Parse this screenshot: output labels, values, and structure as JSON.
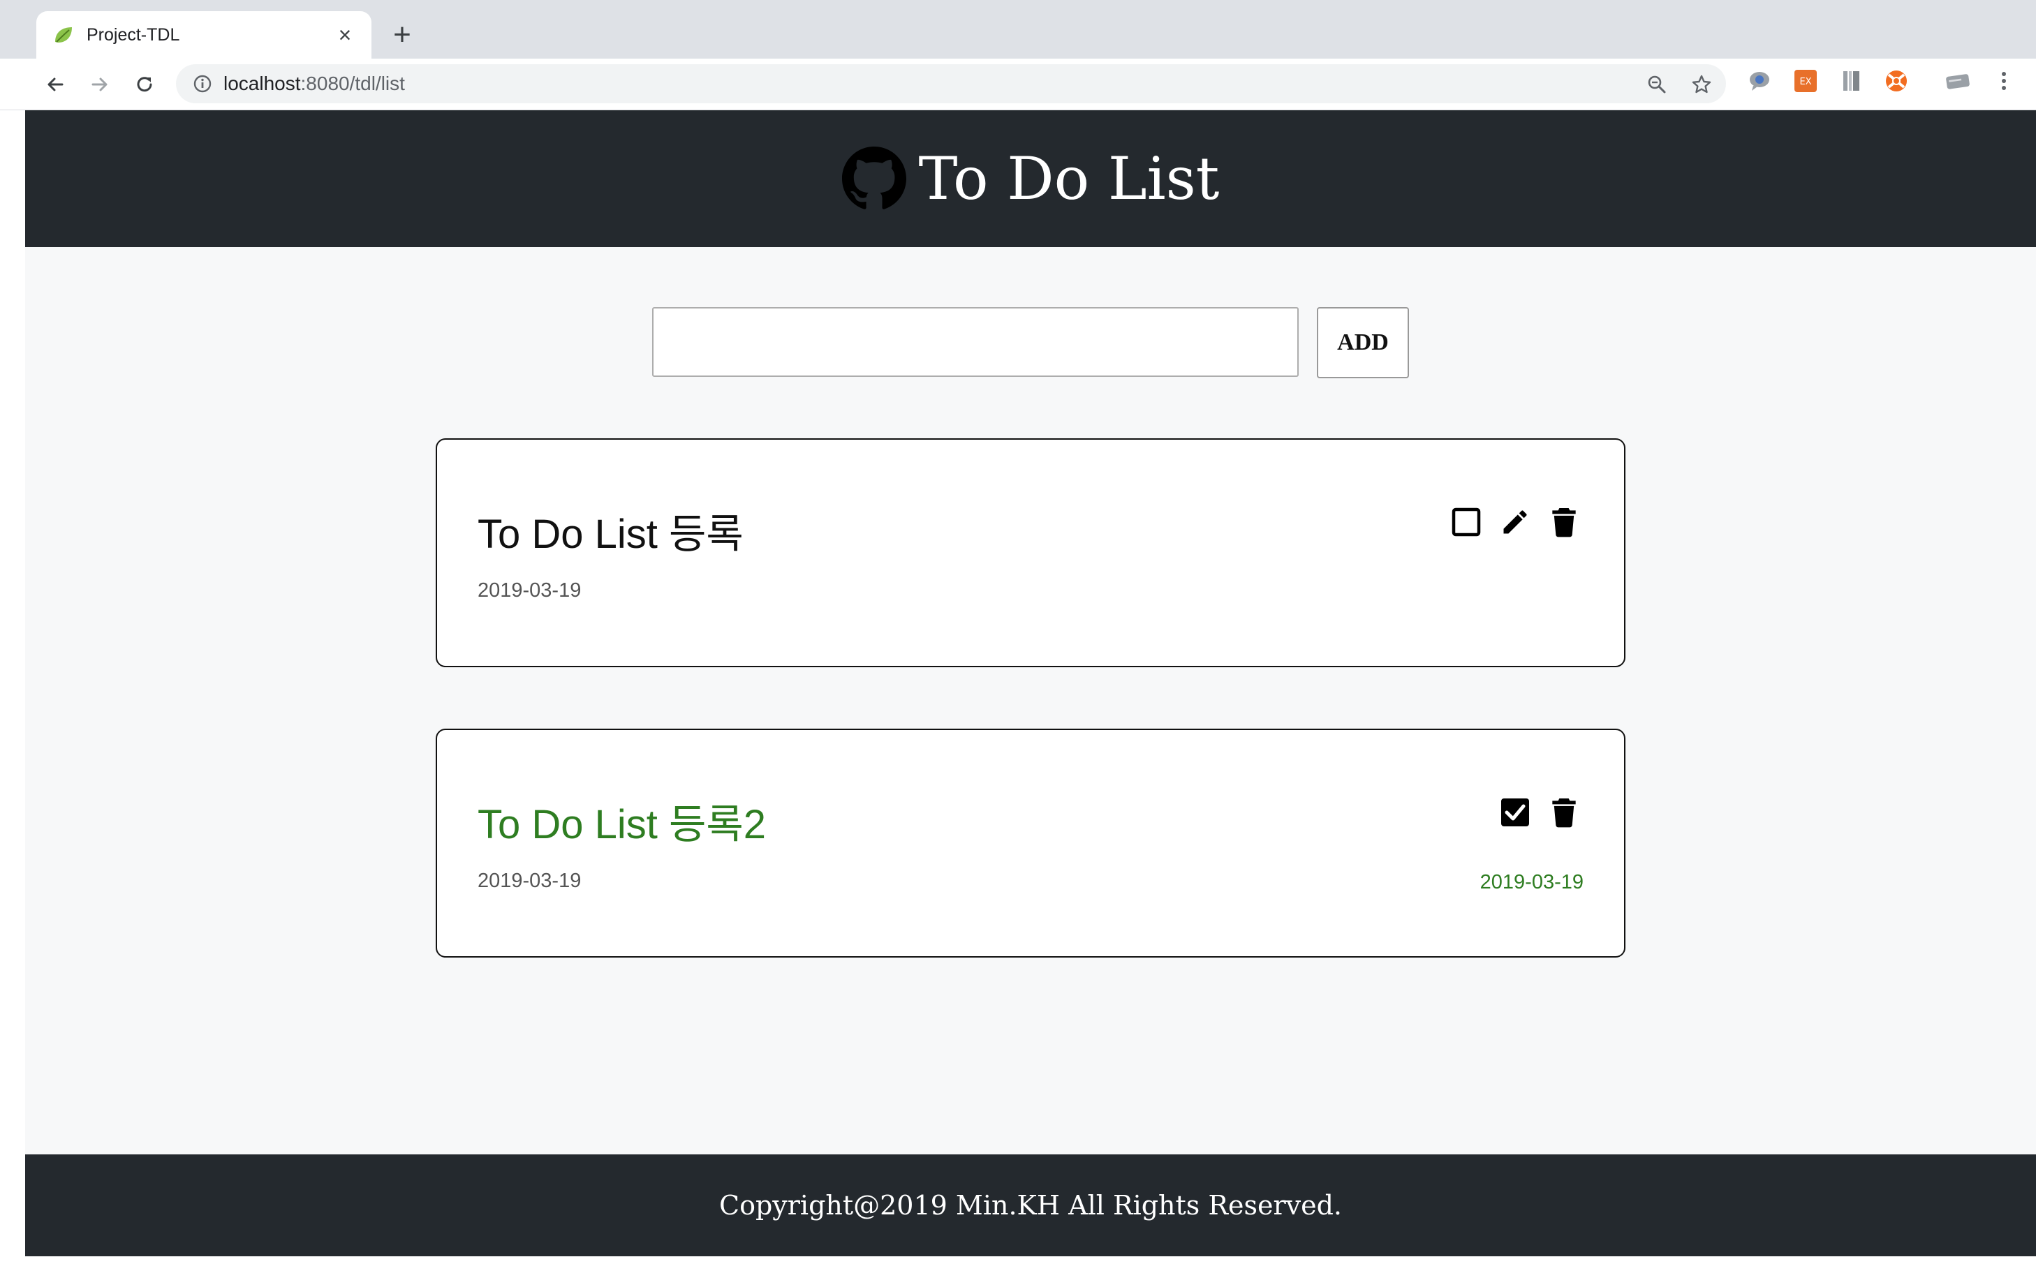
{
  "browser": {
    "tab_title": "Project-TDL",
    "tab_close": "×",
    "new_tab": "+",
    "url_host": "localhost",
    "url_path": ":8080/tdl/list"
  },
  "header": {
    "title": "To Do List"
  },
  "add_form": {
    "input_value": "",
    "button_label": "ADD"
  },
  "todos": [
    {
      "title": "To Do List 등록",
      "created": "2019-03-19",
      "completed": false,
      "completed_date": ""
    },
    {
      "title": "To Do List 등록2",
      "created": "2019-03-19",
      "completed": true,
      "completed_date": "2019-03-19"
    }
  ],
  "footer": {
    "text": "Copyright@2019 Min.KH All Rights Reserved."
  },
  "colors": {
    "header_bg": "#24292e",
    "page_bg": "#f7f8f9",
    "done_green": "#2e7d21"
  }
}
